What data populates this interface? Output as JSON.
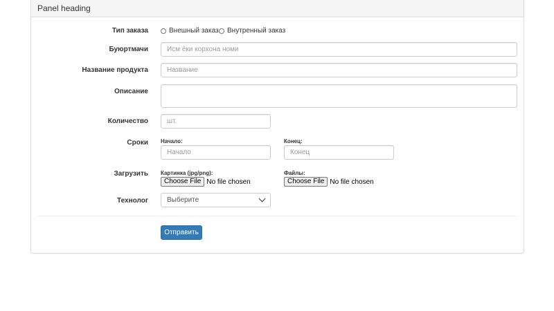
{
  "panel": {
    "heading": "Panel heading"
  },
  "order_type": {
    "label": "Тип заказа",
    "options": [
      "Внешный заказ",
      "Внутренный заказ"
    ]
  },
  "customer": {
    "label": "Буюртмачи",
    "placeholder": "Исм ёки корхона номи"
  },
  "product_name": {
    "label": "Название продукта",
    "placeholder": "Название"
  },
  "description": {
    "label": "Описание",
    "value": ""
  },
  "quantity": {
    "label": "Количество",
    "placeholder": "шт."
  },
  "terms": {
    "label": "Сроки",
    "start_label": "Начало:",
    "start_placeholder": "Начало",
    "end_label": "Конец:",
    "end_placeholder": "Конец"
  },
  "upload": {
    "label": "Загрузить",
    "image_label": "Картинка (jpg/png):",
    "files_label": "Файлы:",
    "choose_button": "Choose File",
    "no_file_text": "No file chosen"
  },
  "technologist": {
    "label": "Технолог",
    "selected": "Выберите"
  },
  "submit": {
    "label": "Отправить"
  },
  "colors": {
    "primary": "#337ab7",
    "heading_bg": "#f5f5f5",
    "border": "#dddddd"
  }
}
